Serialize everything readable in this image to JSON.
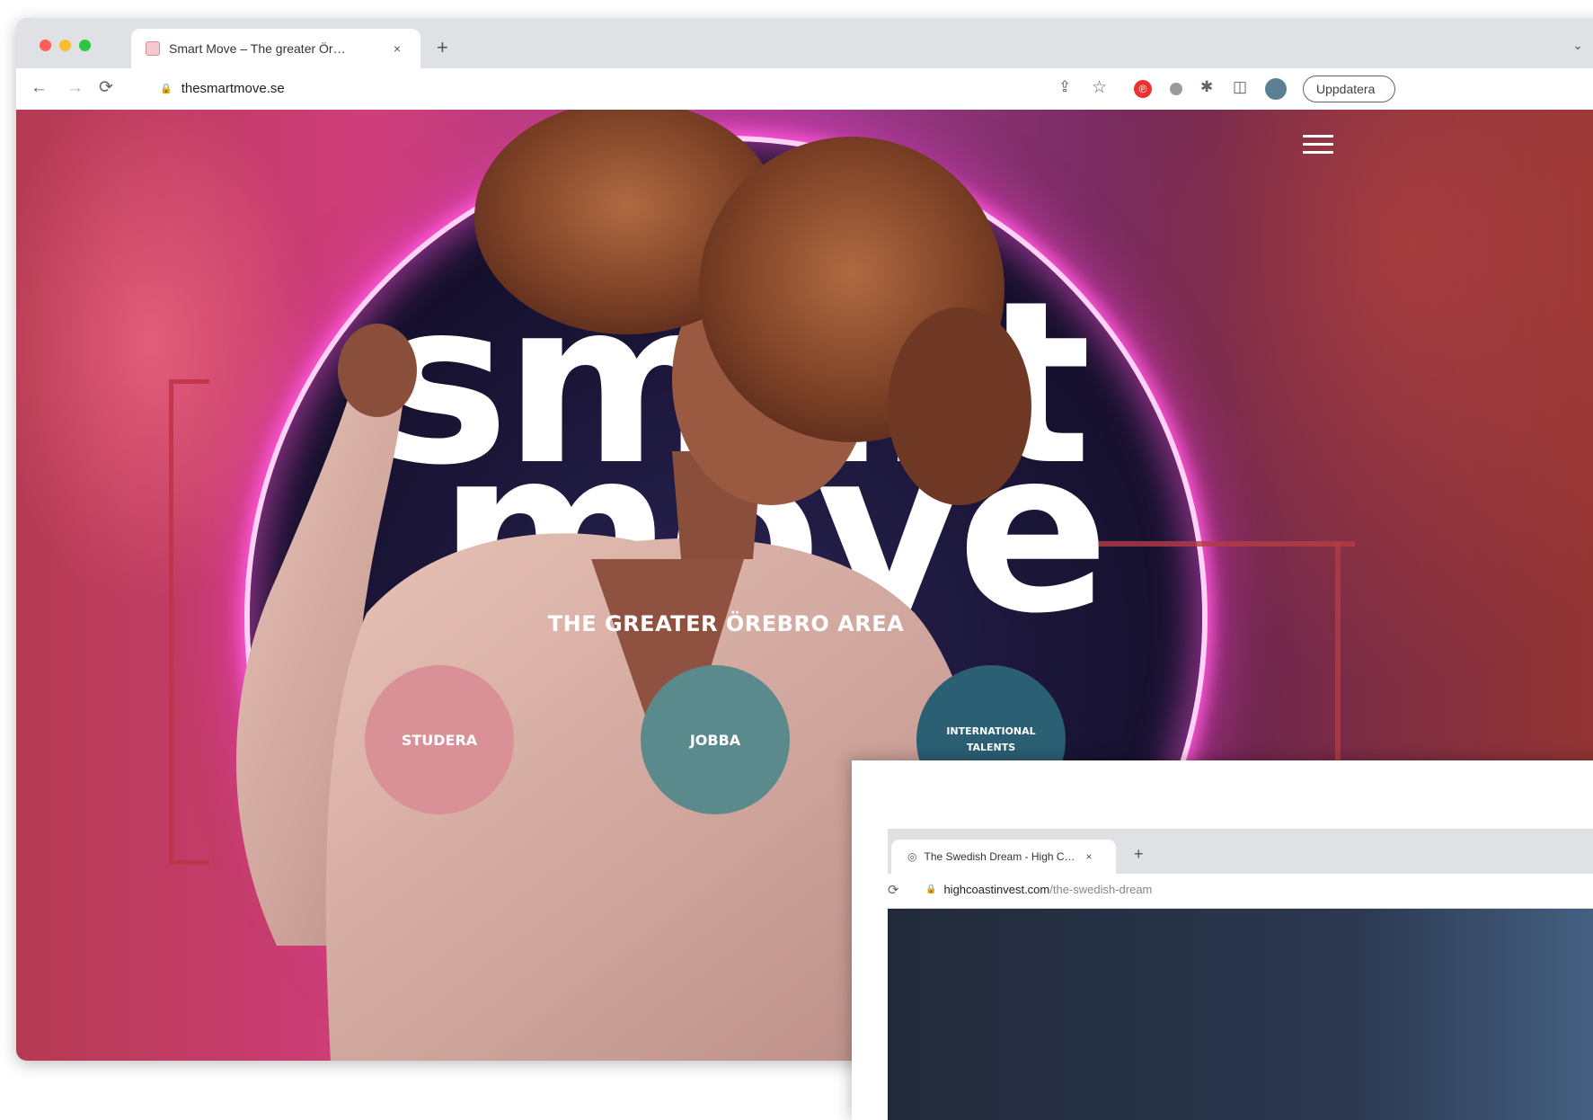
{
  "main_window": {
    "tab": {
      "title": "Smart Move – The greater Ör…",
      "close_glyph": "×"
    },
    "new_tab_glyph": "+",
    "tab_list_glyph": "⌄",
    "toolbar": {
      "back_glyph": "←",
      "forward_glyph": "→",
      "reload_glyph": "⟳",
      "lock_glyph": "🔒",
      "url": "thesmartmove.se",
      "share_glyph": "⇪",
      "star_glyph": "☆",
      "ext_red_glyph": "℗",
      "ext_puzzle_glyph": "✱",
      "sidepanel_glyph": "◫",
      "update_label": "Uppdatera"
    },
    "page": {
      "hero_line1": "smart",
      "hero_line2": "move",
      "tagline": "THE GREATER ÖREBRO AREA",
      "buttons": {
        "studera": "STUDERA",
        "jobba": "JOBBA",
        "international": "INTERNATIONAL TALENTS"
      }
    }
  },
  "second_window": {
    "tab": {
      "title": "The Swedish Dream - High C…",
      "close_glyph": "×"
    },
    "new_tab_glyph": "+",
    "reload_glyph": "⟳",
    "url_host": "highcoastinvest.com",
    "url_path": "/the-swedish-dream"
  }
}
